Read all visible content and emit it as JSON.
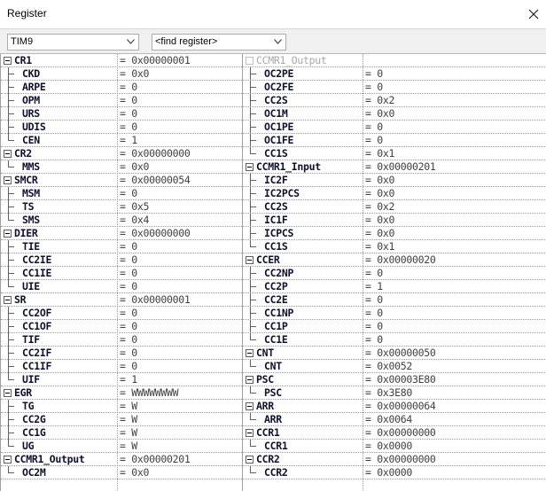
{
  "window": {
    "title": "Register"
  },
  "toolbar": {
    "peripheral_select": "TIM9",
    "find_register_placeholder": "<find register>"
  },
  "left_rows": [
    {
      "name": "CR1",
      "value": "= 0x00000001",
      "kind": "group"
    },
    {
      "name": "CKD",
      "value": "= 0x0",
      "kind": "child"
    },
    {
      "name": "ARPE",
      "value": "= 0",
      "kind": "child"
    },
    {
      "name": "OPM",
      "value": "= 0",
      "kind": "child"
    },
    {
      "name": "URS",
      "value": "= 0",
      "kind": "child"
    },
    {
      "name": "UDIS",
      "value": "= 0",
      "kind": "child"
    },
    {
      "name": "CEN",
      "value": "= 1",
      "kind": "last"
    },
    {
      "name": "CR2",
      "value": "= 0x00000000",
      "kind": "group"
    },
    {
      "name": "MMS",
      "value": "= 0x0",
      "kind": "last"
    },
    {
      "name": "SMCR",
      "value": "= 0x00000054",
      "kind": "group"
    },
    {
      "name": "MSM",
      "value": "= 0",
      "kind": "child"
    },
    {
      "name": "TS",
      "value": "= 0x5",
      "kind": "child"
    },
    {
      "name": "SMS",
      "value": "= 0x4",
      "kind": "last"
    },
    {
      "name": "DIER",
      "value": "= 0x00000000",
      "kind": "group"
    },
    {
      "name": "TIE",
      "value": "= 0",
      "kind": "child"
    },
    {
      "name": "CC2IE",
      "value": "= 0",
      "kind": "child"
    },
    {
      "name": "CC1IE",
      "value": "= 0",
      "kind": "child"
    },
    {
      "name": "UIE",
      "value": "= 0",
      "kind": "last"
    },
    {
      "name": "SR",
      "value": "= 0x00000001",
      "kind": "group"
    },
    {
      "name": "CC2OF",
      "value": "= 0",
      "kind": "child"
    },
    {
      "name": "CC1OF",
      "value": "= 0",
      "kind": "child"
    },
    {
      "name": "TIF",
      "value": "= 0",
      "kind": "child"
    },
    {
      "name": "CC2IF",
      "value": "= 0",
      "kind": "child"
    },
    {
      "name": "CC1IF",
      "value": "= 0",
      "kind": "child"
    },
    {
      "name": "UIF",
      "value": "= 1",
      "kind": "last"
    },
    {
      "name": "EGR",
      "value": "= WWWWWWWW",
      "kind": "group"
    },
    {
      "name": "TG",
      "value": "= W",
      "kind": "child"
    },
    {
      "name": "CC2G",
      "value": "= W",
      "kind": "child"
    },
    {
      "name": "CC1G",
      "value": "= W",
      "kind": "child"
    },
    {
      "name": "UG",
      "value": "= W",
      "kind": "last"
    },
    {
      "name": "CCMR1_Output",
      "value": "= 0x00000201",
      "kind": "group"
    },
    {
      "name": "OC2M",
      "value": "= 0x0",
      "kind": "last"
    }
  ],
  "right_rows": [
    {
      "name": "CCMR1_Output",
      "value": "",
      "kind": "groupdim"
    },
    {
      "name": "OC2PE",
      "value": "= 0",
      "kind": "child"
    },
    {
      "name": "OC2FE",
      "value": "= 0",
      "kind": "child"
    },
    {
      "name": "CC2S",
      "value": "= 0x2",
      "kind": "child"
    },
    {
      "name": "OC1M",
      "value": "= 0x0",
      "kind": "child"
    },
    {
      "name": "OC1PE",
      "value": "= 0",
      "kind": "child"
    },
    {
      "name": "OC1FE",
      "value": "= 0",
      "kind": "child"
    },
    {
      "name": "CC1S",
      "value": "= 0x1",
      "kind": "last"
    },
    {
      "name": "CCMR1_Input",
      "value": "= 0x00000201",
      "kind": "group"
    },
    {
      "name": "IC2F",
      "value": "= 0x0",
      "kind": "child"
    },
    {
      "name": "IC2PCS",
      "value": "= 0x0",
      "kind": "child"
    },
    {
      "name": "CC2S",
      "value": "= 0x2",
      "kind": "child"
    },
    {
      "name": "IC1F",
      "value": "= 0x0",
      "kind": "child"
    },
    {
      "name": "ICPCS",
      "value": "= 0x0",
      "kind": "child"
    },
    {
      "name": "CC1S",
      "value": "= 0x1",
      "kind": "last"
    },
    {
      "name": "CCER",
      "value": "= 0x00000020",
      "kind": "group"
    },
    {
      "name": "CC2NP",
      "value": "= 0",
      "kind": "child"
    },
    {
      "name": "CC2P",
      "value": "= 1",
      "kind": "child"
    },
    {
      "name": "CC2E",
      "value": "= 0",
      "kind": "child"
    },
    {
      "name": "CC1NP",
      "value": "= 0",
      "kind": "child"
    },
    {
      "name": "CC1P",
      "value": "= 0",
      "kind": "child"
    },
    {
      "name": "CC1E",
      "value": "= 0",
      "kind": "last"
    },
    {
      "name": "CNT",
      "value": "= 0x00000050",
      "kind": "group"
    },
    {
      "name": "CNT",
      "value": "= 0x0052",
      "kind": "last"
    },
    {
      "name": "PSC",
      "value": "= 0x00003E80",
      "kind": "group"
    },
    {
      "name": "PSC",
      "value": "= 0x3E80",
      "kind": "last"
    },
    {
      "name": "ARR",
      "value": "= 0x00000064",
      "kind": "group"
    },
    {
      "name": "ARR",
      "value": "= 0x0064",
      "kind": "last"
    },
    {
      "name": "CCR1",
      "value": "= 0x00000000",
      "kind": "group"
    },
    {
      "name": "CCR1",
      "value": "= 0x0000",
      "kind": "last"
    },
    {
      "name": "CCR2",
      "value": "= 0x00000000",
      "kind": "group"
    },
    {
      "name": "CCR2",
      "value": "= 0x0000",
      "kind": "last"
    }
  ]
}
